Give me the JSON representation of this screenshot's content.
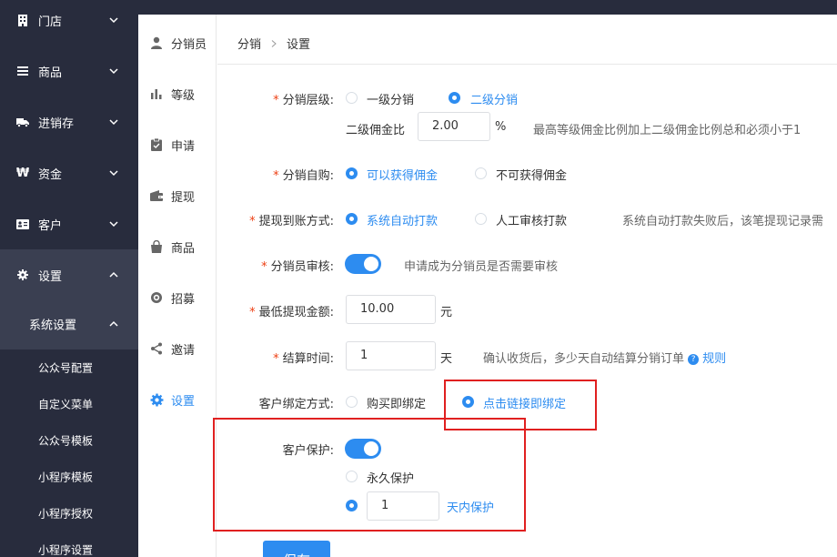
{
  "sidebar": {
    "items": [
      {
        "label": "门店",
        "icon": "store-icon"
      },
      {
        "label": "商品",
        "icon": "list-icon"
      },
      {
        "label": "进销存",
        "icon": "truck-icon"
      },
      {
        "label": "资金",
        "icon": "currency-icon"
      },
      {
        "label": "客户",
        "icon": "id-card-icon"
      },
      {
        "label": "设置",
        "icon": "gear-icon"
      }
    ],
    "submenu_label": "系统设置",
    "leaves": [
      "公众号配置",
      "自定义菜单",
      "公众号模板",
      "小程序模板",
      "小程序授权",
      "小程序设置"
    ]
  },
  "subsidebar": {
    "items": [
      {
        "label": "分销员",
        "icon": "user-icon"
      },
      {
        "label": "等级",
        "icon": "bar-chart-icon"
      },
      {
        "label": "申请",
        "icon": "clipboard-check-icon"
      },
      {
        "label": "提现",
        "icon": "wallet-icon"
      },
      {
        "label": "商品",
        "icon": "bag-icon"
      },
      {
        "label": "招募",
        "icon": "circle-icon"
      },
      {
        "label": "邀请",
        "icon": "share-icon"
      },
      {
        "label": "设置",
        "icon": "gear-icon"
      }
    ]
  },
  "breadcrumb": {
    "root": "分销",
    "current": "设置"
  },
  "form": {
    "level": {
      "label": "分销层级:",
      "opt1": "一级分销",
      "opt2": "二级分销",
      "selected": 2
    },
    "commission": {
      "label": "二级佣金比",
      "value": "2.00",
      "unit": "%",
      "hint": "最高等级佣金比例加上二级佣金比例总和必须小于1"
    },
    "self_buy": {
      "label": "分销自购:",
      "opt1": "可以获得佣金",
      "opt2": "不可获得佣金",
      "selected": 1
    },
    "withdraw": {
      "label": "提现到账方式:",
      "opt1": "系统自动打款",
      "opt2": "人工审核打款",
      "selected": 1,
      "hint": "系统自动打款失败后，该笔提现记录需"
    },
    "audit": {
      "label": "分销员审核:",
      "on": true,
      "hint": "申请成为分销员是否需要审核"
    },
    "min_withdraw": {
      "label": "最低提现金额:",
      "value": "10.00",
      "unit": "元"
    },
    "settle": {
      "label": "结算时间:",
      "value": "1",
      "unit": "天",
      "hint": "确认收货后，多少天自动结算分销订单",
      "rule_link": "规则"
    },
    "bind": {
      "label": "客户绑定方式:",
      "opt1": "购买即绑定",
      "opt2": "点击链接即绑定",
      "selected": 2
    },
    "protect": {
      "label": "客户保护:",
      "on": true,
      "opt1": "永久保护",
      "days_value": "1",
      "opt2": "天内保护",
      "selected": 2
    }
  },
  "save_label": "保存",
  "colors": {
    "accent": "#2d8cf0",
    "sidebar": "#282c3d",
    "highlight": "#e02020",
    "required": "#ed4014"
  }
}
